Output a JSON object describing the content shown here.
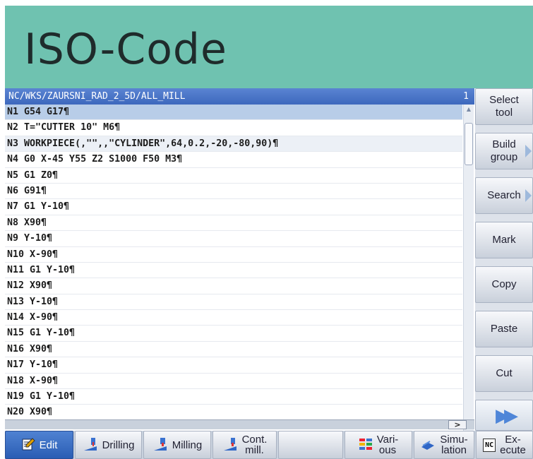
{
  "header": {
    "title": "ISO-Code"
  },
  "editor": {
    "path": "NC/WKS/ZAURSNI_RAD_2_5D/ALL_MILL",
    "index": "1",
    "lines": [
      "N1 G54 G17¶",
      "N2 T=\"CUTTER 10\" M6¶",
      "N3 WORKPIECE(,\"\",,\"CYLINDER\",64,0.2,-20,-80,90)¶",
      "N4 G0 X-45 Y55 Z2 S1000 F50 M3¶",
      "N5 G1 Z0¶",
      "N6 G91¶",
      "N7 G1 Y-10¶",
      "N8 X90¶",
      "N9 Y-10¶",
      "N10 X-90¶",
      "N11 G1 Y-10¶",
      "N12 X90¶",
      "N13 Y-10¶",
      "N14 X-90¶",
      "N15 G1 Y-10¶",
      "N16 X90¶",
      "N17 Y-10¶",
      "N18 X-90¶",
      "N19 G1 Y-10¶",
      "N20 X90¶"
    ],
    "scroll_right_label": ">"
  },
  "softkeys": {
    "select_tool": "Select\ntool",
    "build_group": "Build\ngroup",
    "search": "Search",
    "mark": "Mark",
    "copy": "Copy",
    "paste": "Paste",
    "cut": "Cut",
    "more": "▶▶"
  },
  "bottombar": {
    "edit": "Edit",
    "drilling": "Drilling",
    "milling": "Milling",
    "cont_mill": "Cont.\nmill.",
    "various": "Vari-\nous",
    "simulation": "Simu-\nlation",
    "execute": "Ex-\necute",
    "nc_badge": "NC"
  },
  "colors": {
    "banner": "#6fc2b0",
    "path_bar": "#3d68bd",
    "selected_line": "#b8cde8",
    "active_tab": "#2a5db4"
  }
}
